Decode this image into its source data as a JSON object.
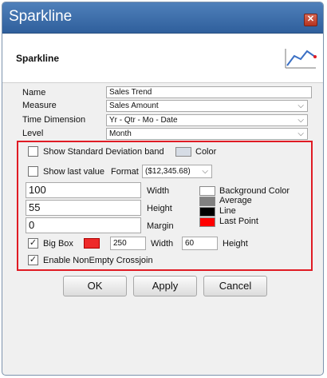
{
  "window": {
    "title": "Sparkline",
    "close_glyph": "✕"
  },
  "header": {
    "title": "Sparkline",
    "icon": "sparkline-chart-icon"
  },
  "form": {
    "name_label": "Name",
    "name_value": "Sales Trend",
    "measure_label": "Measure",
    "measure_value": "Sales Amount",
    "time_label": "Time Dimension",
    "time_value": "Yr - Qtr - Mo - Date",
    "level_label": "Level",
    "level_value": "Month"
  },
  "options": {
    "std_dev_label": "Show Standard Deviation band",
    "std_dev_checked": false,
    "color_label": "Color",
    "color_value": "#d6dce5",
    "last_value_label": "Show last value",
    "last_value_checked": false,
    "format_label": "Format",
    "format_value": "($12,345.68)",
    "width_value": "100",
    "width_label": "Width",
    "height_value": "55",
    "height_label": "Height",
    "margin_value": "0",
    "margin_label": "Margin",
    "legend": [
      {
        "label": "Background Color",
        "color": "#ffffff"
      },
      {
        "label": "Average",
        "color": "#808080"
      },
      {
        "label": "Line",
        "color": "#000000"
      },
      {
        "label": "Last Point",
        "color": "#ff0000"
      }
    ],
    "bigbox_label": "Big Box",
    "bigbox_checked": true,
    "bigbox_color": "#ee2a2a",
    "bigbox_width_value": "250",
    "bigbox_width_label": "Width",
    "bigbox_height_value": "60",
    "bigbox_height_label": "Height",
    "nonempty_label": "Enable NonEmpty Crossjoin",
    "nonempty_checked": true,
    "check_glyph": "✓"
  },
  "buttons": {
    "ok": "OK",
    "apply": "Apply",
    "cancel": "Cancel"
  }
}
